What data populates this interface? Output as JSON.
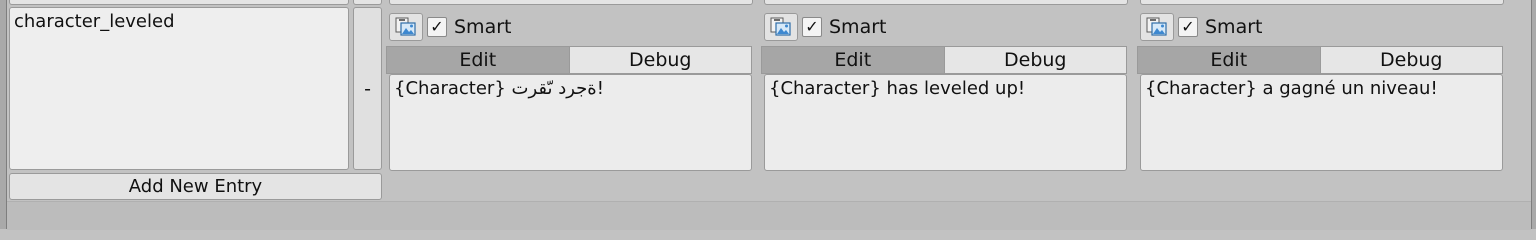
{
  "entry": {
    "key": "character_leveled",
    "remove_label": "-"
  },
  "add_entry_label": "Add New Entry",
  "locales": [
    {
      "smart_label": "Smart",
      "smart_checked": "✓",
      "edit_tab": "Edit",
      "debug_tab": "Debug",
      "value": "{Character} ةجرد ىّقرت!"
    },
    {
      "smart_label": "Smart",
      "smart_checked": "✓",
      "edit_tab": "Edit",
      "debug_tab": "Debug",
      "value": "{Character} has leveled up!"
    },
    {
      "smart_label": "Smart",
      "smart_checked": "✓",
      "edit_tab": "Edit",
      "debug_tab": "Debug",
      "value": "{Character} a gagné un niveau!"
    }
  ],
  "icons": {
    "locale_button": "image-asset-icon",
    "check": "checkmark-icon"
  }
}
